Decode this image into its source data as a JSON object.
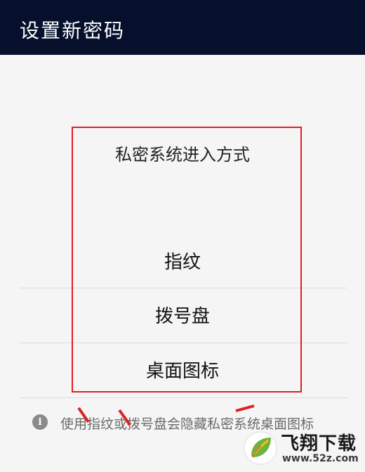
{
  "titlebar": {
    "title": "设置新密码"
  },
  "dialog": {
    "title": "私密系统进入方式",
    "options": [
      "指纹",
      "拨号盘",
      "桌面图标"
    ]
  },
  "info": {
    "icon": "info-icon",
    "icon_glyph": "i",
    "text": "使用指纹或拨号盘会隐藏私密系统桌面图标"
  },
  "watermark": {
    "brand": "飞翔下载",
    "url": "www.52z.com"
  },
  "colors": {
    "titlebar_bg": "#06102d",
    "highlight": "#e01e25",
    "background": "#f5f5f5"
  }
}
